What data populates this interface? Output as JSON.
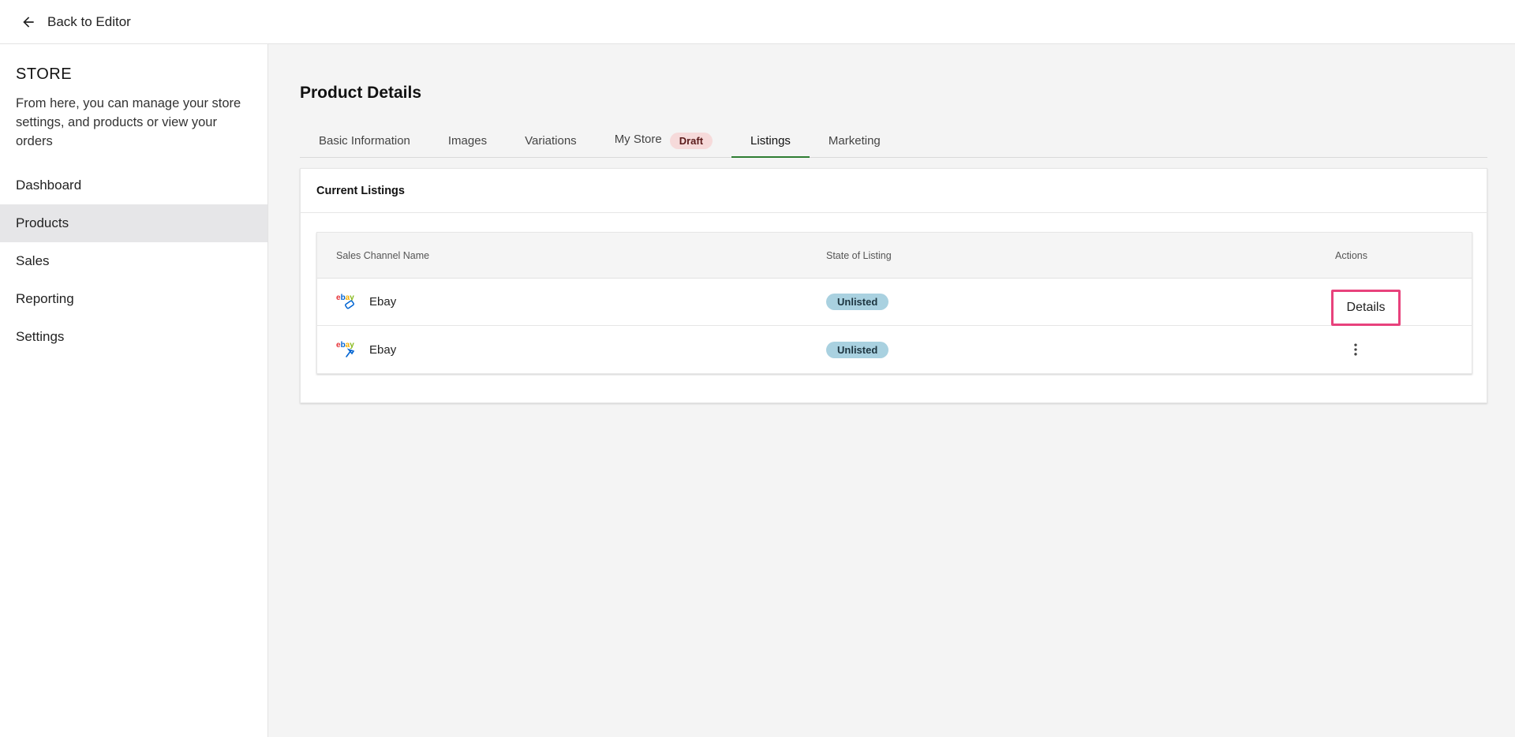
{
  "topbar": {
    "back_label": "Back to Editor"
  },
  "sidebar": {
    "title": "STORE",
    "description": "From here, you can manage your store settings, and products or view your orders",
    "items": [
      {
        "label": "Dashboard"
      },
      {
        "label": "Products"
      },
      {
        "label": "Sales"
      },
      {
        "label": "Reporting"
      },
      {
        "label": "Settings"
      }
    ],
    "active": "Products"
  },
  "main": {
    "title": "Product Details",
    "tabs": [
      {
        "label": "Basic Information"
      },
      {
        "label": "Images"
      },
      {
        "label": "Variations"
      },
      {
        "label": "My Store",
        "badge": "Draft"
      },
      {
        "label": "Listings"
      },
      {
        "label": "Marketing"
      }
    ],
    "active_tab": "Listings",
    "card": {
      "title": "Current Listings",
      "columns": [
        "Sales Channel Name",
        "State of Listing",
        "Actions"
      ],
      "rows": [
        {
          "channel": "Ebay",
          "state": "Unlisted",
          "action": "Details"
        },
        {
          "channel": "Ebay",
          "state": "Unlisted",
          "action": "more-vert-icon"
        }
      ]
    }
  },
  "colors": {
    "active_tab_underline": "#2e7d32",
    "draft_badge_bg": "#f6dada",
    "unlisted_badge_bg": "#a9d1e0",
    "highlight_border": "#e8427c"
  }
}
